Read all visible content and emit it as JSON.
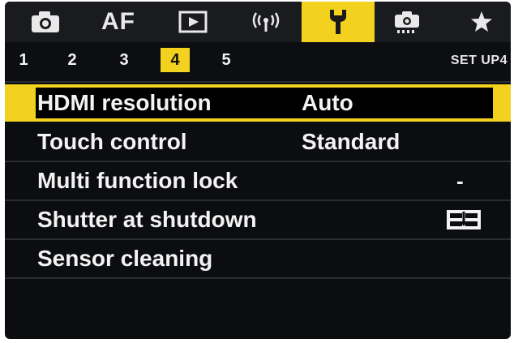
{
  "tabs": [
    {
      "id": "shooting",
      "icon": "camera-icon",
      "active": false
    },
    {
      "id": "af",
      "label": "AF",
      "active": false
    },
    {
      "id": "playback",
      "icon": "playback-icon",
      "active": false
    },
    {
      "id": "wireless",
      "icon": "wireless-icon",
      "active": false
    },
    {
      "id": "setup",
      "icon": "wrench-icon",
      "active": true
    },
    {
      "id": "custom",
      "icon": "custom-camera-icon",
      "active": false
    },
    {
      "id": "mymenu",
      "icon": "star-icon",
      "active": false
    }
  ],
  "subtabs": {
    "items": [
      "1",
      "2",
      "3",
      "4",
      "5"
    ],
    "active_index": 3,
    "section_label": "SET UP4"
  },
  "menu": {
    "items": [
      {
        "label": "HDMI resolution",
        "value": "Auto",
        "selected": true
      },
      {
        "label": "Touch control",
        "value": "Standard",
        "selected": false
      },
      {
        "label": "Multi function lock",
        "value": "-",
        "selected": false
      },
      {
        "label": "Shutter at shutdown",
        "value_icon": "shutter-closed-icon",
        "selected": false
      },
      {
        "label": "Sensor cleaning",
        "value": "",
        "selected": false
      }
    ]
  },
  "colors": {
    "accent": "#f2d21f",
    "background": "#0c0d10",
    "tabbar": "#1a1b1f",
    "text": "#f3f3f3"
  }
}
